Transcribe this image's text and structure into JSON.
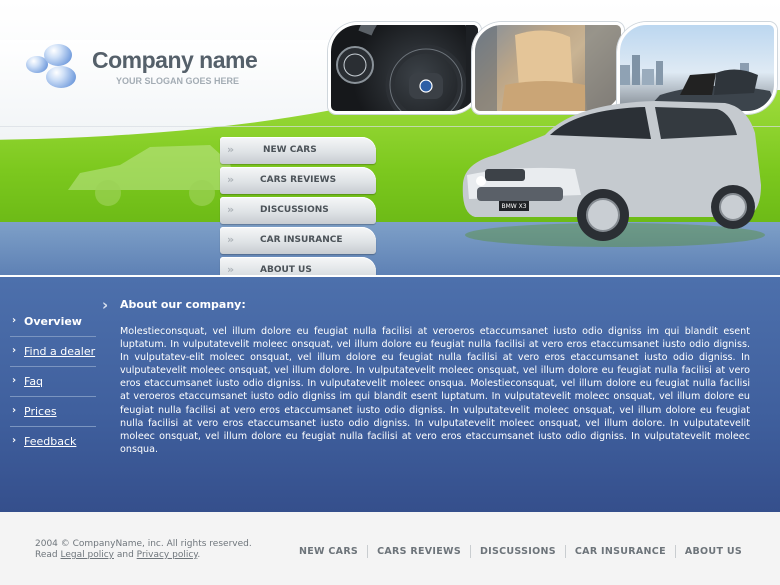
{
  "brand": {
    "name": "Company name",
    "slogan": "YOUR SLOGAN GOES HERE"
  },
  "nav": {
    "items": [
      {
        "label": "NEW CARS"
      },
      {
        "label": "CARS REVIEWS"
      },
      {
        "label": "DISCUSSIONS"
      },
      {
        "label": "CAR INSURANCE"
      },
      {
        "label": "ABOUT US"
      }
    ]
  },
  "car": {
    "plate": "BMW X3"
  },
  "sidebar": {
    "items": [
      {
        "label": "Overview"
      },
      {
        "label": "Find a dealer"
      },
      {
        "label": "Faq"
      },
      {
        "label": "Prices"
      },
      {
        "label": "Feedback"
      }
    ]
  },
  "content": {
    "title": "About our company:",
    "body": "Molestieconsquat, vel illum dolore eu feugiat nulla facilisi at veroeros etaccumsanet iusto odio digniss im qui blandit esent luptatum. In vulputatevelit moleec onsquat, vel illum dolore eu feugiat nulla facilisi at vero eros etaccumsanet iusto odio digniss. In vulputatev-elit moleec onsquat, vel illum dolore eu feugiat nulla facilisi at vero eros etaccumsanet iusto odio digniss. In vulputatevelit moleec onsquat, vel illum dolore. In vulputatevelit moleec onsquat, vel illum dolore eu feugiat nulla facilisi at vero eros etaccumsanet iusto odio digniss. In vulputatevelit moleec onsqua. Molestieconsquat, vel illum dolore eu feugiat nulla facilisi at veroeros etaccumsanet iusto odio digniss im qui blandit esent luptatum. In vulputatevelit moleec onsquat, vel illum dolore eu feugiat nulla facilisi at vero eros etaccumsanet iusto odio digniss. In vulputatevelit moleec onsquat, vel illum dolore eu feugiat nulla facilisi at vero eros etaccumsanet iusto odio digniss. In vulputatevelit moleec onsquat, vel illum dolore. In vulputatevelit moleec onsquat, vel illum dolore eu feugiat nulla facilisi at vero eros etaccumsanet iusto odio digniss. In vulputatevelit moleec onsqua."
  },
  "footer": {
    "copyright": "2004 © CompanyName, inc. All rights reserved.",
    "read": "Read",
    "legal_link": "Legal policy",
    "and": "and",
    "privacy_link": "Privacy policy",
    "period": ".",
    "nav": [
      {
        "label": "NEW CARS"
      },
      {
        "label": "CARS REVIEWS"
      },
      {
        "label": "DISCUSSIONS"
      },
      {
        "label": "CAR INSURANCE"
      },
      {
        "label": "ABOUT US"
      }
    ]
  },
  "colors": {
    "green": "#7cc81e",
    "blue": "#3f5f9d",
    "logo_text": "#55606a"
  }
}
